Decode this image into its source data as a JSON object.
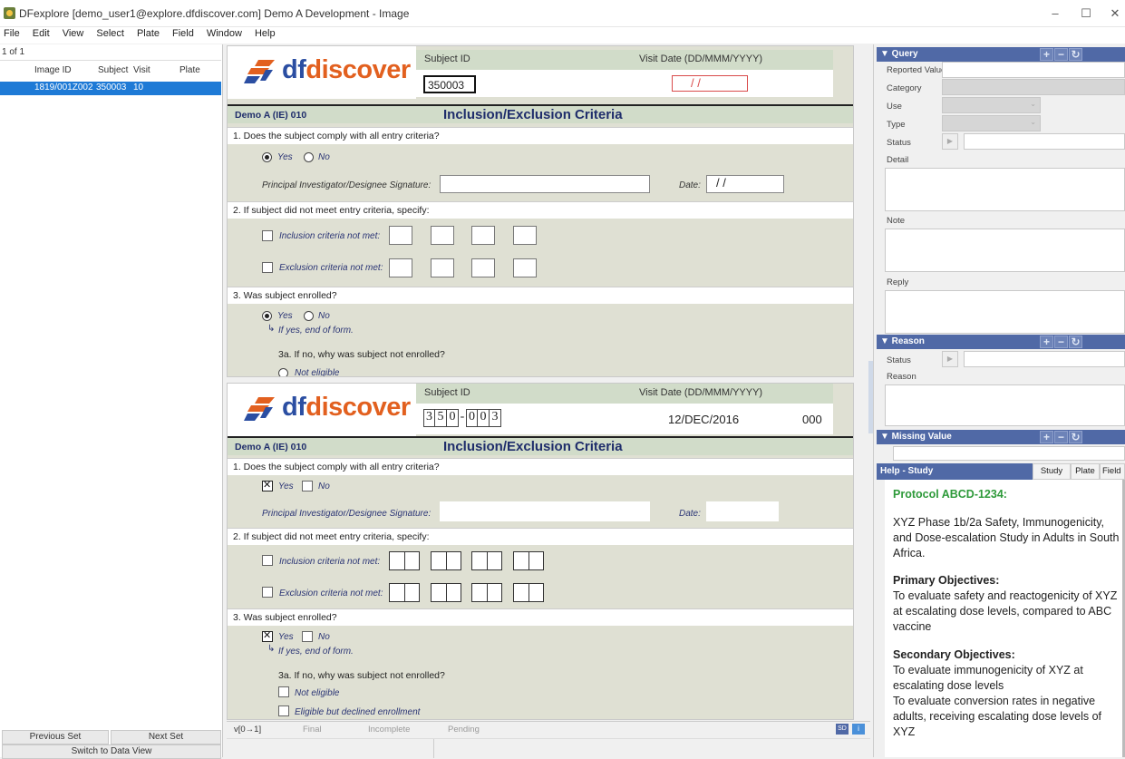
{
  "window": {
    "title": "DFexplore [demo_user1@explore.dfdiscover.com] Demo A Development - Image",
    "controls": [
      "–",
      "☐",
      "✕"
    ]
  },
  "menu": [
    "File",
    "Edit",
    "View",
    "Select",
    "Plate",
    "Field",
    "Window",
    "Help"
  ],
  "list": {
    "count": "1 of 1",
    "headers": {
      "image_id": "Image ID",
      "subject": "Subject",
      "visit": "Visit",
      "plate": "Plate"
    },
    "rows": [
      {
        "image_id": "1819/001Z002",
        "subject": "350003",
        "visit": "10",
        "plate": ""
      }
    ],
    "prev_button": "Previous Set",
    "next_button": "Next Set",
    "switch_button": "Switch to Data View"
  },
  "form_top": {
    "logo_df": "df",
    "logo_rest": "discover",
    "subject_label": "Subject ID",
    "visit_label": "Visit Date (DD/MMM/YYYY)",
    "subject_value": "350003",
    "visit_value": "/ /",
    "form_code": "Demo A (IE) 010",
    "form_title": "Inclusion/Exclusion Criteria",
    "q1": "1.  Does the subject comply with all entry criteria?",
    "yes": "Yes",
    "no": "No",
    "sig_label": "Principal Investigator/Designee Signature:",
    "date_label": "Date:",
    "date_value": "/ /",
    "q2": "2.  If subject did not meet entry criteria, specify:",
    "incl": "Inclusion criteria not met:",
    "excl": "Exclusion criteria not met:",
    "q3": "3.  Was subject enrolled?",
    "if_yes": "If yes, end of form.",
    "q3a": "3a.  If no, why was subject not enrolled?",
    "not_eligible": "Not eligible"
  },
  "form_bottom": {
    "subject_label": "Subject ID",
    "visit_label": "Visit Date (DD/MMM/YYYY)",
    "subject_digits": [
      "3",
      "5",
      "0",
      "0",
      "0",
      "3"
    ],
    "visit_value": "12/DEC/2016",
    "seq": "000",
    "form_code": "Demo A (IE) 010",
    "form_title": "Inclusion/Exclusion Criteria",
    "q1": "1.  Does the subject comply with all entry criteria?",
    "yes": "Yes",
    "no": "No",
    "sig_label": "Principal Investigator/Designee Signature:",
    "date_label": "Date:",
    "q2": "2.  If subject did not meet entry criteria, specify:",
    "incl": "Inclusion criteria not met:",
    "excl": "Exclusion criteria not met:",
    "q3": "3.  Was subject enrolled?",
    "if_yes": "If yes, end of form.",
    "q3a": "3a.  If no, why was subject not enrolled?",
    "not_eligible": "Not eligible",
    "declined": "Eligible but declined enrollment"
  },
  "status": {
    "version": "v[0→1]",
    "final": "Final",
    "incomplete": "Incomplete",
    "pending": "Pending",
    "sd": "SD",
    "info": "i"
  },
  "query": {
    "title": "▼ Query",
    "reported_value": "Reported Value",
    "category": "Category",
    "use": "Use",
    "type": "Type",
    "status": "Status",
    "detail": "Detail",
    "note": "Note",
    "reply": "Reply"
  },
  "reason": {
    "title": "▼ Reason",
    "status": "Status",
    "reason": "Reason"
  },
  "missing": {
    "title": "▼ Missing Value"
  },
  "help": {
    "title": "Help - Study",
    "tabs": [
      "Study",
      "Plate",
      "Field"
    ],
    "protocol": "Protocol ABCD-1234:",
    "intro": "XYZ Phase 1b/2a Safety, Immunogenicity, and Dose-escalation Study in Adults in South Africa.",
    "primary_h": "Primary Objectives:",
    "primary": "To evaluate safety and reactogenicity of XYZ at escalating dose levels, compared to ABC vaccine",
    "secondary_h": "Secondary Objectives:",
    "secondary1": "To evaluate immunogenicity of XYZ at escalating dose levels",
    "secondary2": "To evaluate conversion rates in negative adults, receiving escalating dose levels of XYZ"
  },
  "colors": {
    "accent": "#1e7ad6",
    "panel_header": "#5069a6",
    "form_bg": "#dfe0d3",
    "logo_orange": "#e2601f",
    "logo_blue": "#2b4ea2",
    "protocol_green": "#2e9a3a"
  }
}
